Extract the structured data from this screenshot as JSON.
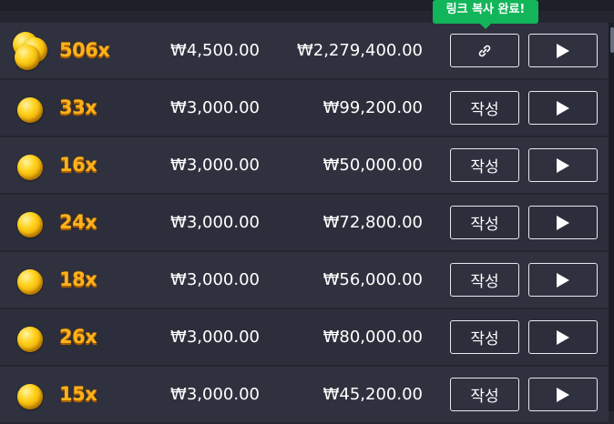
{
  "tooltip": {
    "text": "링크 복사 완료!"
  },
  "rows": [
    {
      "multiplier": "506x",
      "bet": "₩4,500.00",
      "win": "₩2,279,400.00",
      "action": "",
      "action_icon": "link-icon",
      "coin": "pile"
    },
    {
      "multiplier": "33x",
      "bet": "₩3,000.00",
      "win": "₩99,200.00",
      "action": "작성",
      "coin": "single"
    },
    {
      "multiplier": "16x",
      "bet": "₩3,000.00",
      "win": "₩50,000.00",
      "action": "작성",
      "coin": "single"
    },
    {
      "multiplier": "24x",
      "bet": "₩3,000.00",
      "win": "₩72,800.00",
      "action": "작성",
      "coin": "single"
    },
    {
      "multiplier": "18x",
      "bet": "₩3,000.00",
      "win": "₩56,000.00",
      "action": "작성",
      "coin": "single"
    },
    {
      "multiplier": "26x",
      "bet": "₩3,000.00",
      "win": "₩80,000.00",
      "action": "작성",
      "coin": "single"
    },
    {
      "multiplier": "15x",
      "bet": "₩3,000.00",
      "win": "₩45,200.00",
      "action": "작성",
      "coin": "single"
    }
  ],
  "colors": {
    "accent_gold": "#ffb21a",
    "tooltip_green": "#12b55a",
    "row_bg": "#2f313f"
  }
}
